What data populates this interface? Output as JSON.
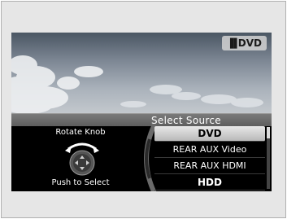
{
  "badge": {
    "icon": "hdd-h-icon",
    "label": "DVD"
  },
  "source_bar": {
    "title": "Select Source"
  },
  "hints": {
    "top": "Rotate Knob",
    "bottom": "Push to Select"
  },
  "menu": {
    "items": [
      {
        "label": "DVD",
        "selected": true
      },
      {
        "label": "REAR AUX Video",
        "selected": false
      },
      {
        "label": "REAR AUX HDMI",
        "selected": false
      },
      {
        "label": "HDD",
        "selected": false
      }
    ]
  },
  "colors": {
    "frame_bg": "#e6e6e6",
    "selected_bg": "#d0d0d0",
    "screen_bg": "#000000"
  }
}
